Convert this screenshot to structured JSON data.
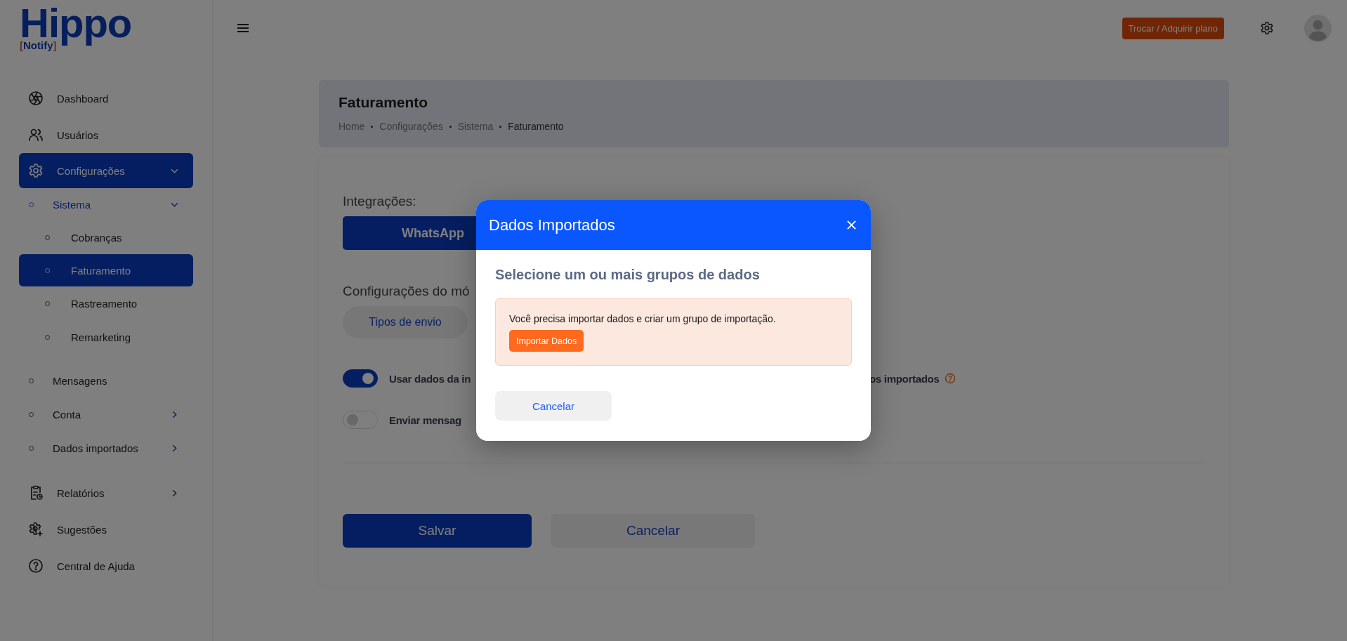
{
  "logo": {
    "word": "Hippo",
    "tag_open": "[",
    "tag": "Notify",
    "tag_close": "]"
  },
  "header": {
    "plan_button": "Trocar / Adquirir plano"
  },
  "sidebar": {
    "items": [
      {
        "label": "Dashboard",
        "selected": false
      },
      {
        "label": "Usuários",
        "selected": false
      },
      {
        "label": "Configurações",
        "selected": true,
        "expanded": true,
        "children": [
          {
            "label": "Sistema",
            "selected": true,
            "expanded": true,
            "children": [
              {
                "label": "Cobranças",
                "selected": false
              },
              {
                "label": "Faturamento",
                "selected": true
              },
              {
                "label": "Rastreamento",
                "selected": false
              },
              {
                "label": "Remarketing",
                "selected": false
              }
            ]
          },
          {
            "label": "Mensagens",
            "selected": false
          },
          {
            "label": "Conta",
            "selected": false,
            "expanded": false
          },
          {
            "label": "Dados importados",
            "selected": false,
            "expanded": false
          }
        ]
      },
      {
        "label": "Relatórios",
        "selected": false,
        "expanded": false
      },
      {
        "label": "Sugestões",
        "selected": false
      },
      {
        "label": "Central de Ajuda",
        "selected": false
      }
    ]
  },
  "page_header": {
    "title": "Faturamento",
    "breadcrumb": [
      "Home",
      "Configurações",
      "Sistema",
      "Faturamento"
    ]
  },
  "form": {
    "integrations_label": "Integrações:",
    "integrations": [
      {
        "label": "WhatsApp",
        "selected": true
      }
    ],
    "module_label": "Configurações do mó",
    "module_tabs": [
      {
        "label": "Tipos de envio",
        "selected": false
      }
    ],
    "toggles": [
      {
        "label": "Usar dados da in",
        "label_right": "os importados",
        "help": true,
        "on": true
      },
      {
        "label": "Enviar mensag",
        "on": false
      }
    ],
    "save": "Salvar",
    "cancel": "Cancelar"
  },
  "modal": {
    "title": "Dados Importados",
    "heading": "Selecione um ou mais grupos de dados",
    "alert": "Você precisa importar dados e criar um grupo de importação.",
    "alert_button": "Importar Dados",
    "cancel": "Cancelar"
  }
}
